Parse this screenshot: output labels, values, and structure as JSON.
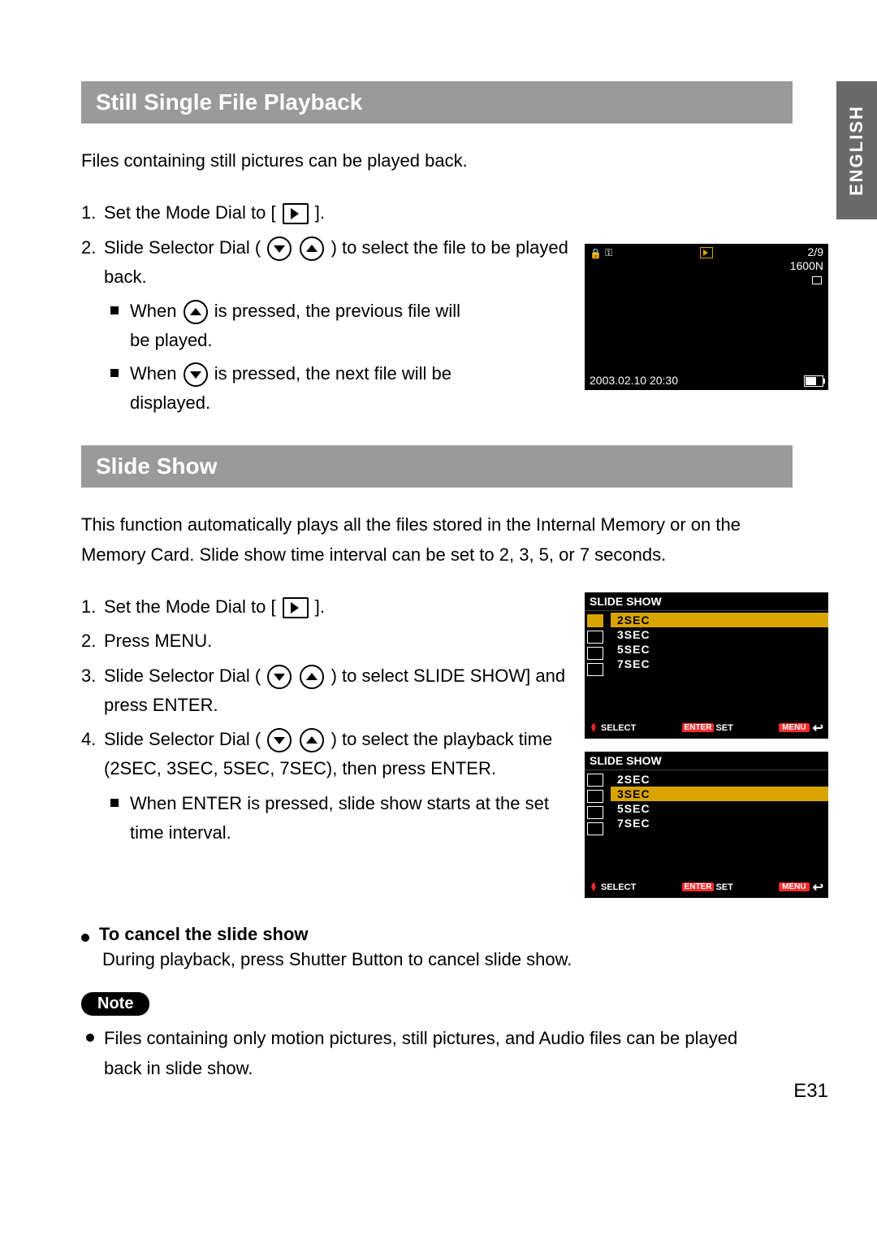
{
  "language_tab": "ENGLISH",
  "page_number": "E31",
  "section1": {
    "title": "Still Single File Playback",
    "intro": "Files containing still pictures can be played back.",
    "step1_pre": "Set the Mode Dial to [ ",
    "step1_post": " ].",
    "step2_pre": "Slide Selector Dial ( ",
    "step2_post": " ) to select the file to be played back.",
    "sub_a_pre": "When",
    "sub_a_post": " is pressed, the previous file will be played.",
    "sub_b_pre": "When",
    "sub_b_post": " is pressed, the next file will be displayed."
  },
  "playback_screen": {
    "counter": "2/9",
    "resolution": "1600N",
    "timestamp": "2003.02.10  20:30"
  },
  "section2": {
    "title": "Slide Show",
    "intro": "This function automatically plays all the files stored in the Internal Memory or on the Memory Card. Slide show time interval can be set to 2, 3, 5, or 7 seconds.",
    "step1_pre": "Set the Mode Dial to [ ",
    "step1_post": " ].",
    "step2": "Press MENU.",
    "step3_pre": "Slide Selector Dial ( ",
    "step3_post": " ) to select SLIDE SHOW] and press ENTER.",
    "step4_pre": "Slide Selector Dial ( ",
    "step4_post": " ) to select the playback time (2SEC, 3SEC, 5SEC, 7SEC), then press ENTER.",
    "step4_sub": "When ENTER is pressed, slide show starts at the set time interval.",
    "cancel_title": "To cancel the slide show",
    "cancel_text": "During playback, press Shutter Button to cancel slide show.",
    "note_label": "Note",
    "note_text": "Files containing only motion pictures, still pictures, and Audio files can be played back in slide show."
  },
  "menu_screen": {
    "title": "SLIDE SHOW",
    "options": [
      "2SEC",
      "3SEC",
      "5SEC",
      "7SEC"
    ],
    "footer_select": "SELECT",
    "footer_enter": "ENTER",
    "footer_set": "SET",
    "footer_menu": "MENU"
  }
}
